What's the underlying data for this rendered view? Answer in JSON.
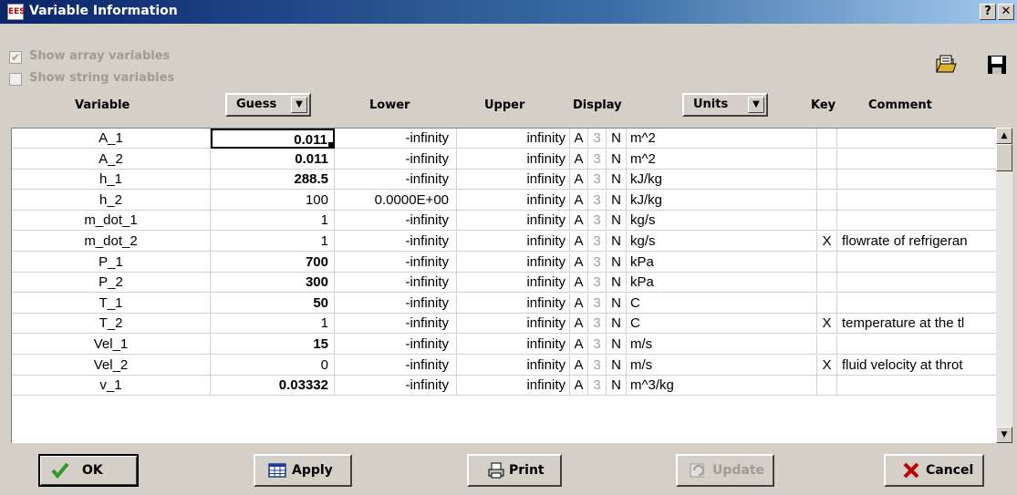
{
  "window": {
    "title": "Variable Information",
    "help_label": "?",
    "close_label": "✕"
  },
  "options": {
    "show_array_variables": {
      "label": "Show array variables",
      "checked": true,
      "disabled": true
    },
    "show_string_variables": {
      "label": "Show string variables",
      "checked": false,
      "disabled": true
    }
  },
  "toolbar": {
    "open_icon": "open-folder-icon",
    "save_icon": "floppy-disk-icon"
  },
  "columns": {
    "variable": "Variable",
    "guess": "Guess",
    "lower": "Lower",
    "upper": "Upper",
    "display": "Display",
    "units": "Units",
    "key": "Key",
    "comment": "Comment"
  },
  "rows": [
    {
      "variable": "A_1",
      "guess": "0.011",
      "guess_bold": true,
      "lower": "-infinity",
      "upper": "infinity",
      "fmt": "A",
      "digits": "3",
      "dflag": "N",
      "units": "m^2",
      "key": "",
      "comment": ""
    },
    {
      "variable": "A_2",
      "guess": "0.011",
      "guess_bold": true,
      "lower": "-infinity",
      "upper": "infinity",
      "fmt": "A",
      "digits": "3",
      "dflag": "N",
      "units": "m^2",
      "key": "",
      "comment": ""
    },
    {
      "variable": "h_1",
      "guess": "288.5",
      "guess_bold": true,
      "lower": "-infinity",
      "upper": "infinity",
      "fmt": "A",
      "digits": "3",
      "dflag": "N",
      "units": "kJ/kg",
      "key": "",
      "comment": ""
    },
    {
      "variable": "h_2",
      "guess": "100",
      "guess_bold": false,
      "lower": "0.0000E+00",
      "upper": "infinity",
      "fmt": "A",
      "digits": "3",
      "dflag": "N",
      "units": "kJ/kg",
      "key": "",
      "comment": ""
    },
    {
      "variable": "m_dot_1",
      "guess": "1",
      "guess_bold": false,
      "lower": "-infinity",
      "upper": "infinity",
      "fmt": "A",
      "digits": "3",
      "dflag": "N",
      "units": "kg/s",
      "key": "",
      "comment": ""
    },
    {
      "variable": "m_dot_2",
      "guess": "1",
      "guess_bold": false,
      "lower": "-infinity",
      "upper": "infinity",
      "fmt": "A",
      "digits": "3",
      "dflag": "N",
      "units": "kg/s",
      "key": "X",
      "comment": "flowrate of refrigeran"
    },
    {
      "variable": "P_1",
      "guess": "700",
      "guess_bold": true,
      "lower": "-infinity",
      "upper": "infinity",
      "fmt": "A",
      "digits": "3",
      "dflag": "N",
      "units": "kPa",
      "key": "",
      "comment": ""
    },
    {
      "variable": "P_2",
      "guess": "300",
      "guess_bold": true,
      "lower": "-infinity",
      "upper": "infinity",
      "fmt": "A",
      "digits": "3",
      "dflag": "N",
      "units": "kPa",
      "key": "",
      "comment": ""
    },
    {
      "variable": "T_1",
      "guess": "50",
      "guess_bold": true,
      "lower": "-infinity",
      "upper": "infinity",
      "fmt": "A",
      "digits": "3",
      "dflag": "N",
      "units": "C",
      "key": "",
      "comment": ""
    },
    {
      "variable": "T_2",
      "guess": "1",
      "guess_bold": false,
      "lower": "-infinity",
      "upper": "infinity",
      "fmt": "A",
      "digits": "3",
      "dflag": "N",
      "units": "C",
      "key": "X",
      "comment": "temperature at the tl"
    },
    {
      "variable": "Vel_1",
      "guess": "15",
      "guess_bold": true,
      "lower": "-infinity",
      "upper": "infinity",
      "fmt": "A",
      "digits": "3",
      "dflag": "N",
      "units": "m/s",
      "key": "",
      "comment": ""
    },
    {
      "variable": "Vel_2",
      "guess": "0",
      "guess_bold": false,
      "lower": "-infinity",
      "upper": "infinity",
      "fmt": "A",
      "digits": "3",
      "dflag": "N",
      "units": "m/s",
      "key": "X",
      "comment": "fluid velocity at throt"
    },
    {
      "variable": "v_1",
      "guess": "0.03332",
      "guess_bold": true,
      "lower": "-infinity",
      "upper": "infinity",
      "fmt": "A",
      "digits": "3",
      "dflag": "N",
      "units": "m^3/kg",
      "key": "",
      "comment": ""
    }
  ],
  "buttons": {
    "ok": "OK",
    "apply": "Apply",
    "print": "Print",
    "update": "Update",
    "cancel": "Cancel"
  },
  "colors": {
    "titlebar": "#0a246a",
    "ok_check": "#2e9a2e",
    "cancel_x": "#c00000"
  }
}
